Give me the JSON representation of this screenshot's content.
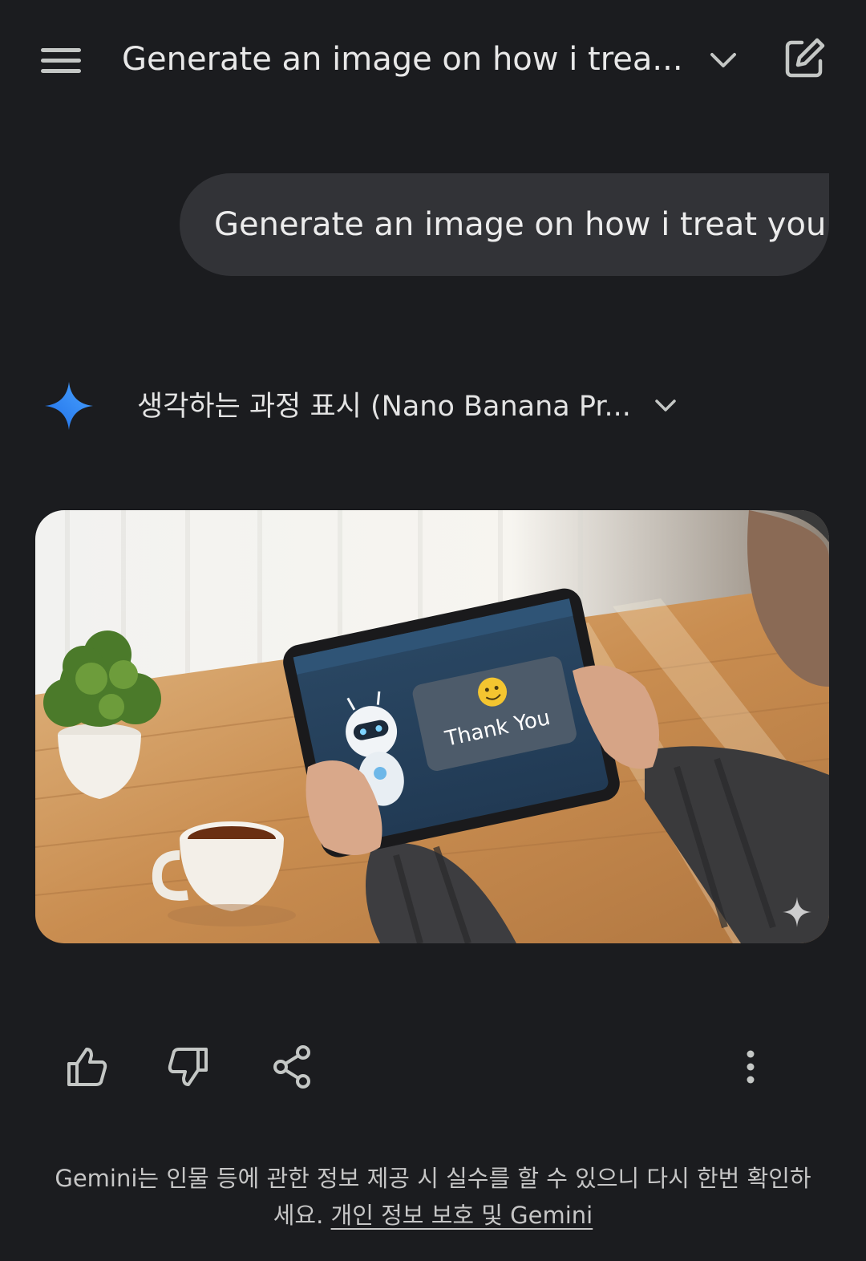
{
  "header": {
    "title": "Generate an image on how i trea...",
    "menu_icon": "hamburger-menu-icon",
    "dropdown_icon": "chevron-down-icon",
    "new_chat_icon": "edit-icon"
  },
  "conversation": {
    "user_message": "Generate an image on how i treat you",
    "response": {
      "thinking_label": "생각하는 과정 표시 (Nano Banana Pr...",
      "image": {
        "speech_bubble_text": "Thank You",
        "description_icon": "sparkle-icon"
      },
      "actions": [
        {
          "name": "thumbs-up",
          "icon": "thumbs-up-icon"
        },
        {
          "name": "thumbs-down",
          "icon": "thumbs-down-icon"
        },
        {
          "name": "share",
          "icon": "share-icon"
        },
        {
          "name": "more",
          "icon": "more-vert-icon"
        }
      ]
    }
  },
  "footer": {
    "disclaimer_text": "Gemini는 인물 등에 관한 정보 제공 시 실수를 할 수 있으니 다시 한번 확인하세요.",
    "privacy_link": "개인 정보 보호 및 Gemini"
  },
  "colors": {
    "background": "#1b1c1f",
    "bubble": "#323337",
    "gemini_blue": "#4285f4"
  }
}
